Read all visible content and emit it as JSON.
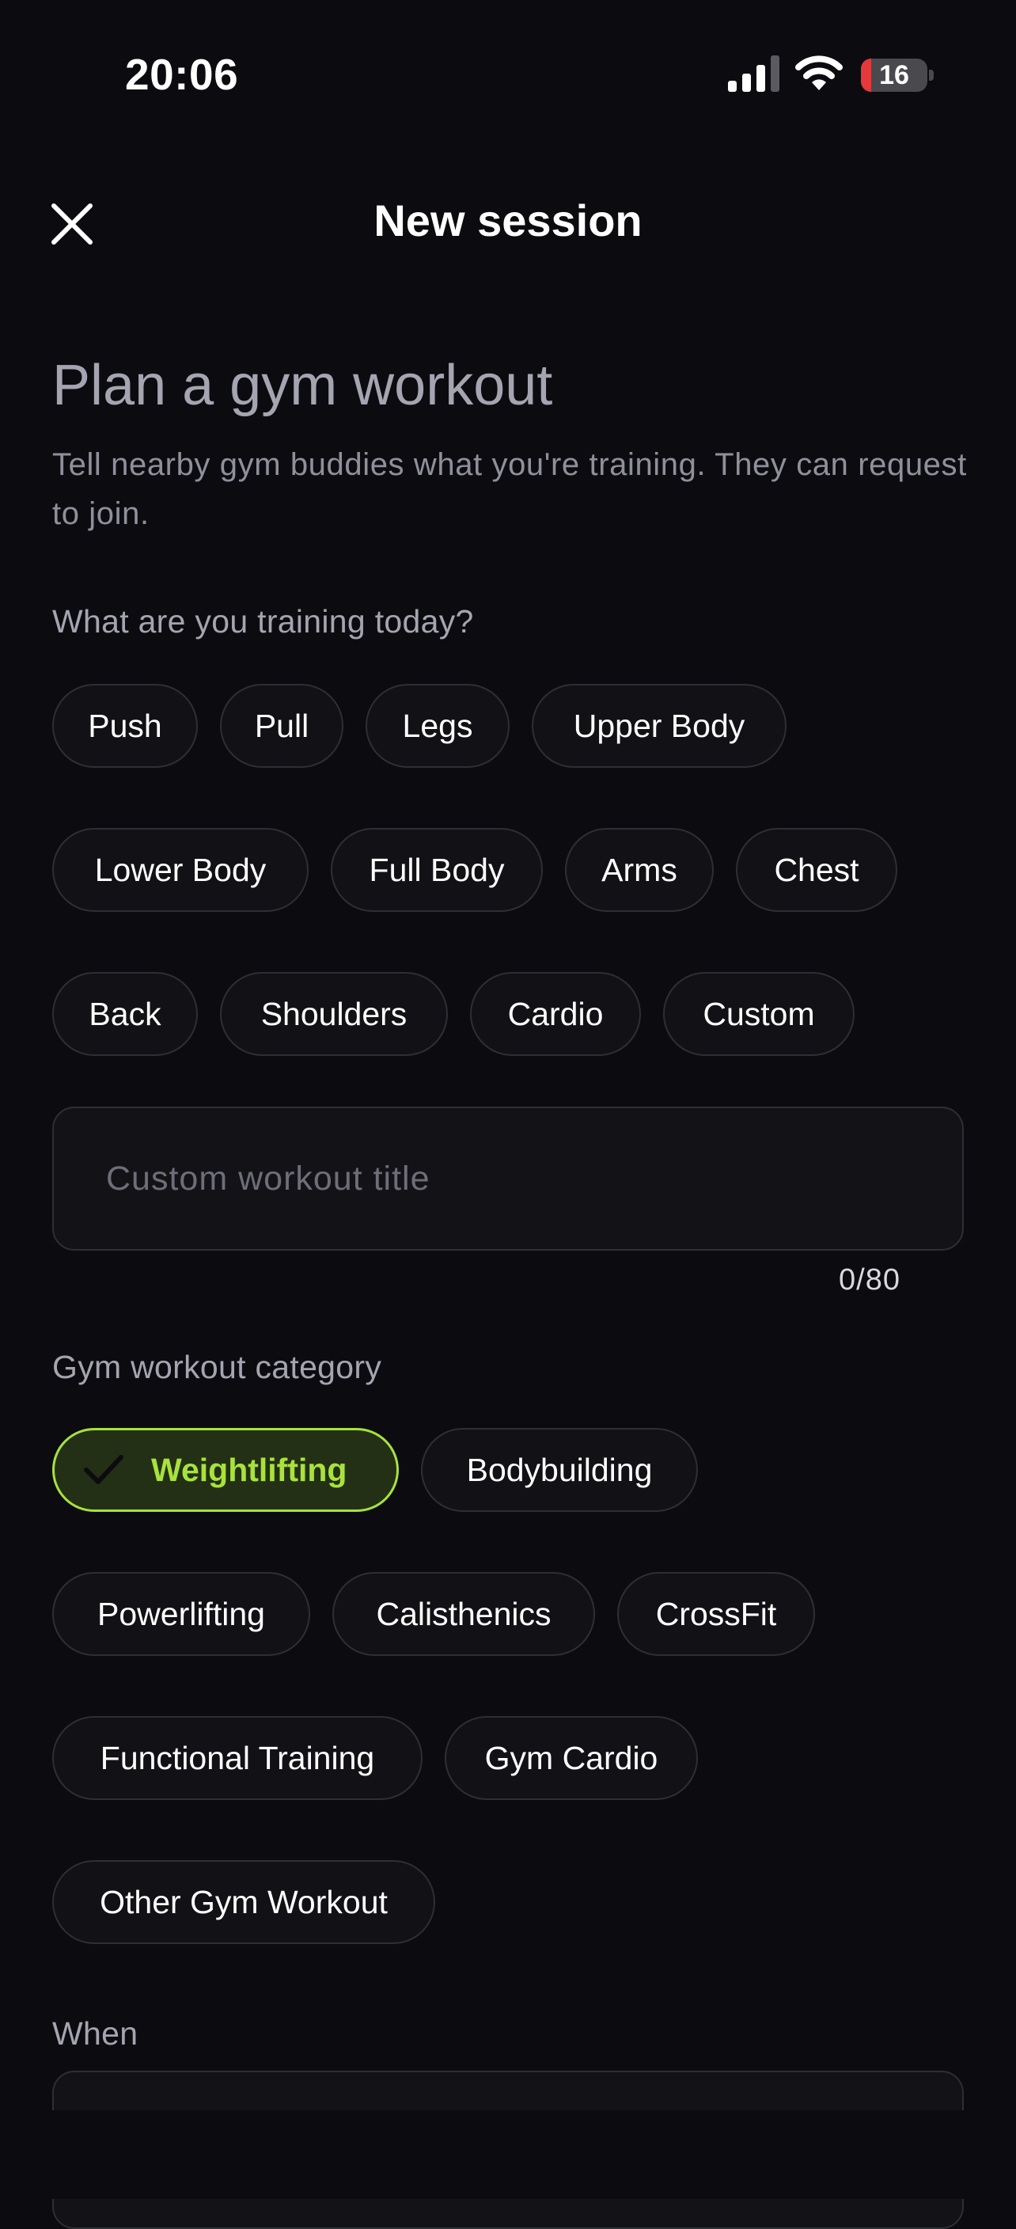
{
  "status_bar": {
    "time": "20:06",
    "battery_level": "16",
    "icons": [
      "signal-icon",
      "wifi-icon",
      "battery-icon"
    ]
  },
  "header": {
    "close_icon": "close-icon",
    "title": "New session"
  },
  "intro": {
    "heading": "Plan a gym workout",
    "description": "Tell nearby gym buddies what you're training. They can request to join."
  },
  "training": {
    "label": "What are you training today?",
    "options": [
      "Push",
      "Pull",
      "Legs",
      "Upper Body",
      "Lower Body",
      "Full Body",
      "Arms",
      "Chest",
      "Back",
      "Shoulders",
      "Cardio",
      "Custom"
    ]
  },
  "custom_title": {
    "placeholder": "Custom workout title",
    "value": "",
    "counter": "0/80"
  },
  "category": {
    "label": "Gym workout category",
    "selected": "Weightlifting",
    "options": [
      "Weightlifting",
      "Bodybuilding",
      "Powerlifting",
      "Calisthenics",
      "CrossFit",
      "Functional Training",
      "Gym Cardio",
      "Other Gym Workout"
    ]
  },
  "when": {
    "label": "When"
  },
  "colors": {
    "background": "#0c0c10",
    "accent": "#a8e23b",
    "chip_border": "#2e2e34",
    "muted_text": "#a4a5b0"
  }
}
